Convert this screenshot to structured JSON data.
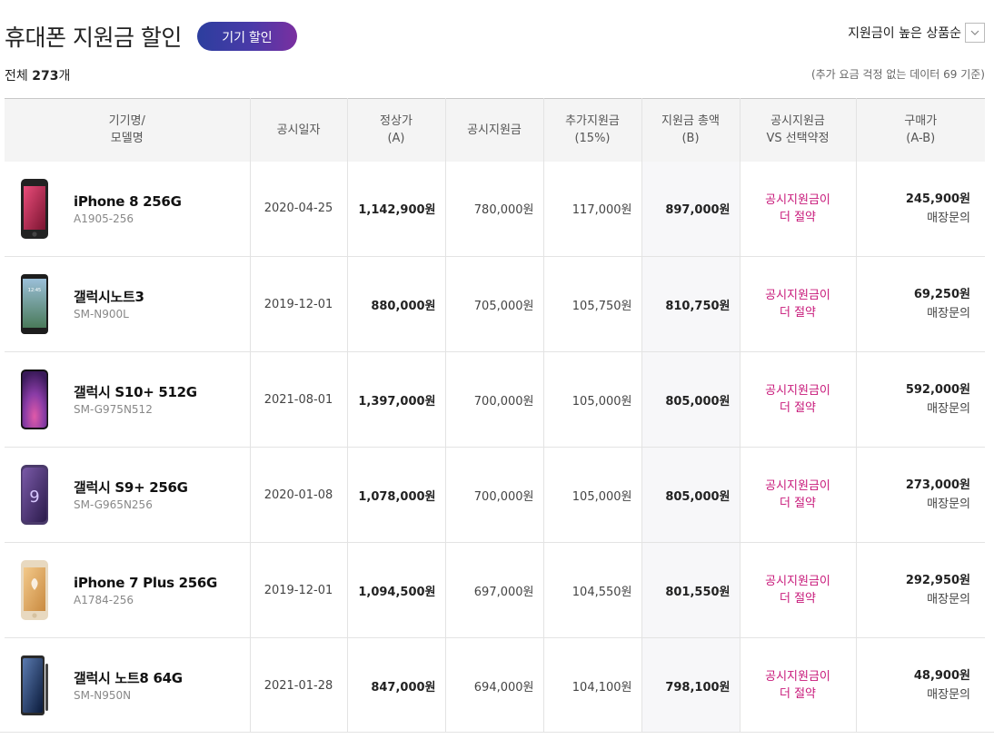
{
  "header": {
    "title": "휴대폰 지원금 할인",
    "pill_label": "기기 할인",
    "sort_label": "지원금이 높은 상품순",
    "total_prefix": "전체",
    "total_count": "273",
    "total_suffix": "개",
    "note": "(추가 요금 걱정 없는 데이터 69 기준)"
  },
  "columns": [
    {
      "line1": "기기명/",
      "line2": "모델명"
    },
    {
      "line1": "공시일자",
      "line2": ""
    },
    {
      "line1": "정상가",
      "line2": "(A)"
    },
    {
      "line1": "공시지원금",
      "line2": ""
    },
    {
      "line1": "추가지원금",
      "line2": "(15%)"
    },
    {
      "line1": "지원금 총액",
      "line2": "(B)"
    },
    {
      "line1": "공시지원금",
      "line2": "VS 선택약정"
    },
    {
      "line1": "구매가",
      "line2": "(A-B)"
    }
  ],
  "rows": [
    {
      "name": "iPhone 8 256G",
      "model": "A1905-256",
      "date": "2020-04-25",
      "price": "1,142,900원",
      "subsidy": "780,000원",
      "extra": "117,000원",
      "total": "897,000원",
      "cmp1": "공시지원금이",
      "cmp2": "더 절약",
      "final": "245,900원",
      "inquiry": "매장문의",
      "phone": "iphone8"
    },
    {
      "name": "갤럭시노트3",
      "model": "SM-N900L",
      "date": "2019-12-01",
      "price": "880,000원",
      "subsidy": "705,000원",
      "extra": "105,750원",
      "total": "810,750원",
      "cmp1": "공시지원금이",
      "cmp2": "더 절약",
      "final": "69,250원",
      "inquiry": "매장문의",
      "phone": "note3"
    },
    {
      "name": "갤럭시 S10+ 512G",
      "model": "SM-G975N512",
      "date": "2021-08-01",
      "price": "1,397,000원",
      "subsidy": "700,000원",
      "extra": "105,000원",
      "total": "805,000원",
      "cmp1": "공시지원금이",
      "cmp2": "더 절약",
      "final": "592,000원",
      "inquiry": "매장문의",
      "phone": "s10plus"
    },
    {
      "name": "갤럭시 S9+ 256G",
      "model": "SM-G965N256",
      "date": "2020-01-08",
      "price": "1,078,000원",
      "subsidy": "700,000원",
      "extra": "105,000원",
      "total": "805,000원",
      "cmp1": "공시지원금이",
      "cmp2": "더 절약",
      "final": "273,000원",
      "inquiry": "매장문의",
      "phone": "s9plus"
    },
    {
      "name": "iPhone 7 Plus 256G",
      "model": "A1784-256",
      "date": "2019-12-01",
      "price": "1,094,500원",
      "subsidy": "697,000원",
      "extra": "104,550원",
      "total": "801,550원",
      "cmp1": "공시지원금이",
      "cmp2": "더 절약",
      "final": "292,950원",
      "inquiry": "매장문의",
      "phone": "iphone7plus"
    },
    {
      "name": "갤럭시 노트8 64G",
      "model": "SM-N950N",
      "date": "2021-01-28",
      "price": "847,000원",
      "subsidy": "694,000원",
      "extra": "104,100원",
      "total": "798,100원",
      "cmp1": "공시지원금이",
      "cmp2": "더 절약",
      "final": "48,900원",
      "inquiry": "매장문의",
      "phone": "note8"
    }
  ],
  "colors": {
    "accent": "#c8197a",
    "pill_start": "#2c3e9e",
    "pill_end": "#7a2fa0"
  }
}
